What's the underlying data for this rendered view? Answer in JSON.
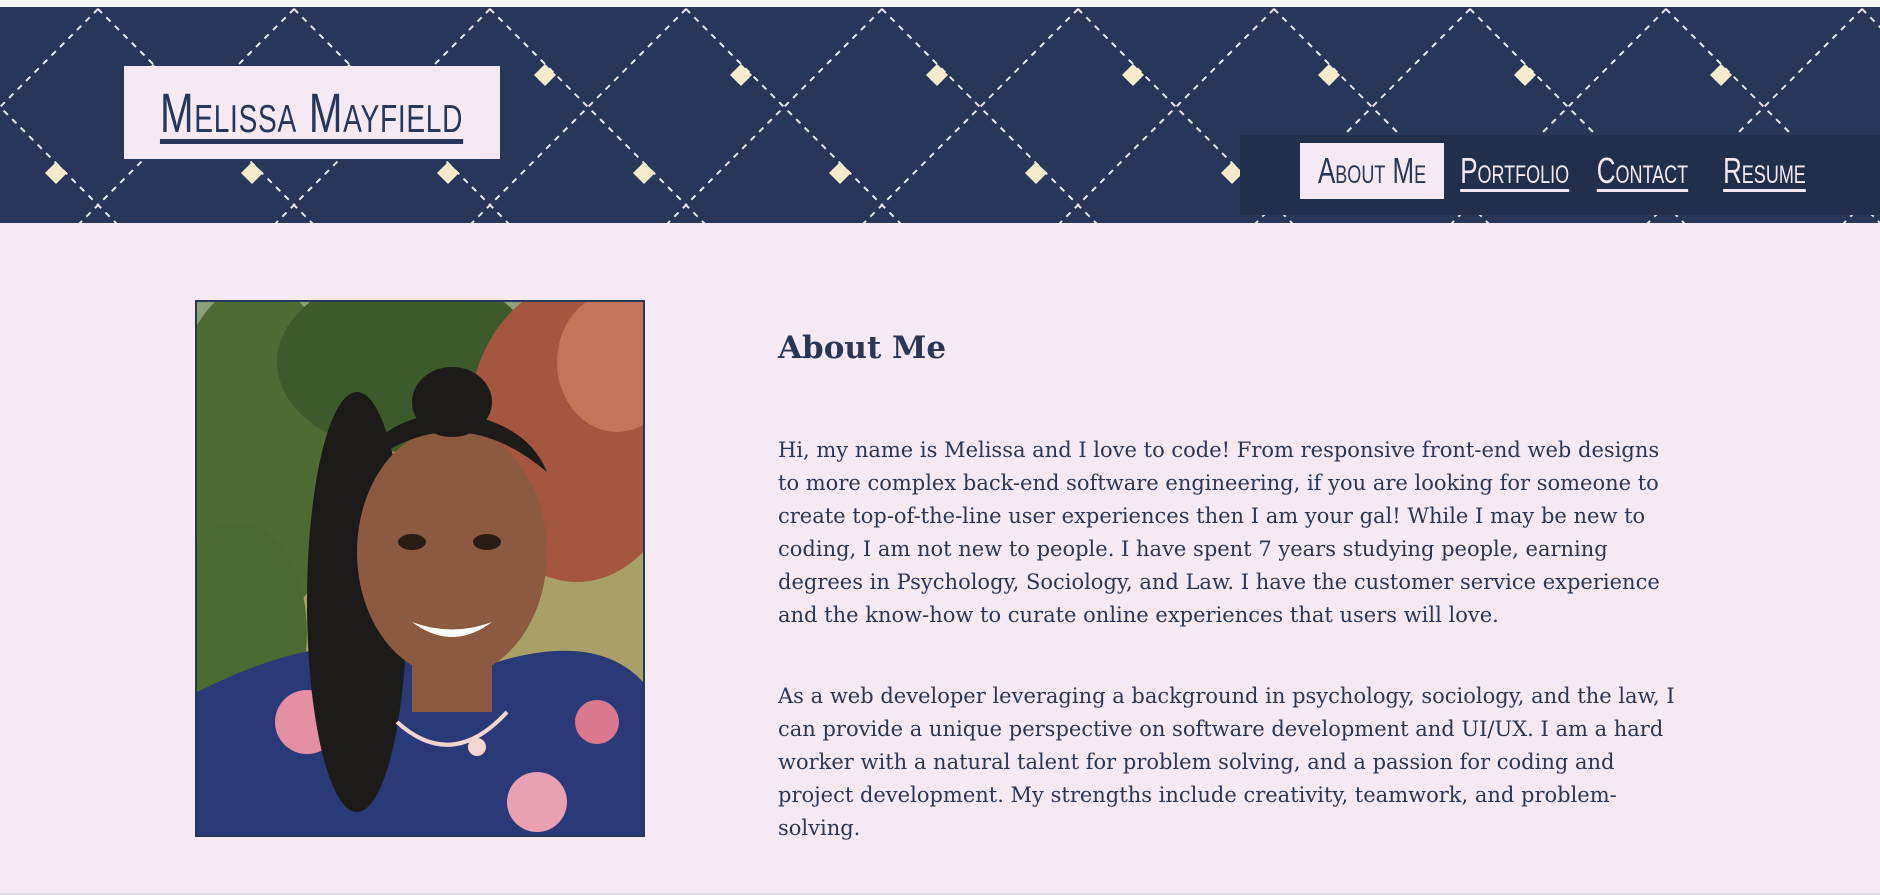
{
  "header": {
    "logo_text": "Melissa Mayfield",
    "nav": [
      {
        "label": "About Me",
        "active": true
      },
      {
        "label": "Portfolio",
        "active": false
      },
      {
        "label": "Contact",
        "active": false
      },
      {
        "label": "Resume",
        "active": false
      }
    ]
  },
  "main": {
    "heading": "About Me",
    "paragraphs": [
      "Hi, my name is Melissa and I love to code! From responsive front-end web designs to more complex back-end software engineering, if you are looking for someone to create top-of-the-line user experiences then I am your gal! While I may be new to coding, I am not new to people. I have spent 7 years studying people, earning degrees in Psychology, Sociology, and Law. I have the customer service experience and the know-how to curate online experiences that users will love.",
      "As a web developer leveraging a background in psychology, sociology, and the law, I can provide a unique perspective on software development and UI/UX. I am a hard worker with a natural talent for problem solving, and a passion for coding and project development. My strengths include creativity, teamwork, and problem-solving."
    ]
  },
  "colors": {
    "navy": "#283759",
    "background": "#f5e9f3",
    "diamond": "#f3ebcc"
  }
}
